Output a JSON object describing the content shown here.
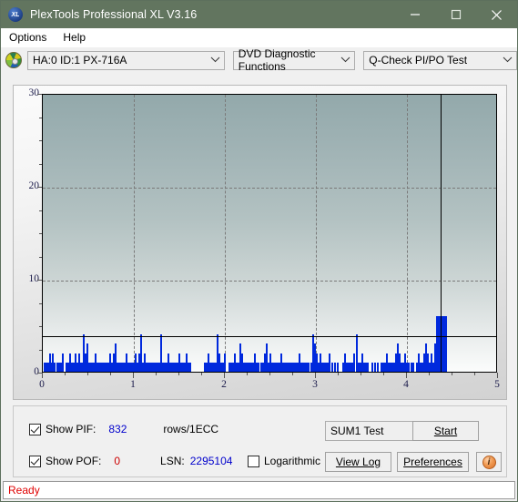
{
  "window": {
    "title": "PlexTools Professional XL V3.16",
    "app_icon": "XL",
    "minimize_icon": "minimize-icon",
    "maximize_icon": "maximize-icon",
    "close_icon": "close-icon"
  },
  "menubar": {
    "items": [
      {
        "label": "Options"
      },
      {
        "label": "Help"
      }
    ]
  },
  "toolbar": {
    "disc_icon": "disc-icon",
    "drive_select": {
      "value": "HA:0 ID:1  PX-716A",
      "caret": "⌄"
    },
    "function_select": {
      "value": "DVD Diagnostic Functions",
      "caret": "⌄"
    },
    "test_select": {
      "value": "Q-Check PI/PO Test",
      "caret": "⌄"
    }
  },
  "controls": {
    "show_pif": {
      "label": "Show PIF:",
      "checked": true,
      "value": "832",
      "unit": "rows/1ECC"
    },
    "show_pof": {
      "label": "Show POF:",
      "checked": true,
      "value": "0"
    },
    "lsn": {
      "label": "LSN:",
      "value": "2295104"
    },
    "logarithmic": {
      "label": "Logarithmic",
      "checked": false
    },
    "sum_select": {
      "value": "SUM1 Test",
      "caret": "⌄"
    },
    "start_button": "Start",
    "view_log_button": "View Log",
    "preferences_button": "Preferences",
    "info_button": "i"
  },
  "statusbar": {
    "text": "Ready"
  },
  "colors": {
    "titlebar": "#62755f",
    "bar_blue": "#0029dd",
    "baseline_teal": "#00c8c8",
    "value_blue": "#0000cc",
    "value_red": "#cc0000",
    "status_red": "#e00000"
  },
  "chart_data": {
    "type": "bar",
    "title": "",
    "xlabel": "",
    "ylabel": "",
    "xlim": [
      0,
      5
    ],
    "ylim": [
      0,
      30
    ],
    "xticks": [
      0,
      1,
      2,
      3,
      4,
      5
    ],
    "xtick_labels": [
      "0",
      "1",
      "2",
      "3",
      "4",
      "5"
    ],
    "yticks": [
      0,
      10,
      20,
      30
    ],
    "ytick_labels": [
      "0",
      "10",
      "20",
      "30"
    ],
    "y_minor_ticks": [
      2.5,
      5,
      7.5,
      12.5,
      15,
      17.5,
      22.5,
      25,
      27.5
    ],
    "x_minor_ticks": [
      0.25,
      0.5,
      0.75,
      1.25,
      1.5,
      1.75,
      2.25,
      2.5,
      2.75,
      3.25,
      3.5,
      3.75,
      4.25,
      4.5,
      4.75
    ],
    "grid": {
      "vertical_dashed_at": [
        1,
        2,
        3,
        4
      ],
      "horizontal_dashed_at": [
        10,
        20
      ]
    },
    "threshold_line": {
      "y": 4,
      "color": "#000000"
    },
    "data_end_line": {
      "x": 4.37,
      "color": "#000000"
    },
    "baseline": {
      "y": 0,
      "color": "#00c8c8",
      "x_end": 4.37
    },
    "series": [
      {
        "name": "PIF",
        "color": "#0029dd",
        "points": [
          [
            0.02,
            1
          ],
          [
            0.04,
            1
          ],
          [
            0.055,
            1
          ],
          [
            0.075,
            2
          ],
          [
            0.09,
            1
          ],
          [
            0.105,
            2
          ],
          [
            0.125,
            1
          ],
          [
            0.155,
            1
          ],
          [
            0.175,
            1
          ],
          [
            0.195,
            1
          ],
          [
            0.215,
            2
          ],
          [
            0.255,
            1
          ],
          [
            0.275,
            1
          ],
          [
            0.3,
            2
          ],
          [
            0.315,
            1
          ],
          [
            0.335,
            1
          ],
          [
            0.355,
            2
          ],
          [
            0.375,
            1
          ],
          [
            0.395,
            2
          ],
          [
            0.415,
            1
          ],
          [
            0.435,
            1
          ],
          [
            0.45,
            4
          ],
          [
            0.465,
            2
          ],
          [
            0.485,
            3
          ],
          [
            0.5,
            1
          ],
          [
            0.515,
            1
          ],
          [
            0.535,
            1
          ],
          [
            0.555,
            1
          ],
          [
            0.575,
            2
          ],
          [
            0.595,
            1
          ],
          [
            0.615,
            1
          ],
          [
            0.635,
            1
          ],
          [
            0.66,
            1
          ],
          [
            0.68,
            1
          ],
          [
            0.7,
            1
          ],
          [
            0.715,
            1
          ],
          [
            0.735,
            2
          ],
          [
            0.755,
            1
          ],
          [
            0.775,
            2
          ],
          [
            0.8,
            3
          ],
          [
            0.815,
            1
          ],
          [
            0.835,
            1
          ],
          [
            0.855,
            1
          ],
          [
            0.875,
            1
          ],
          [
            0.895,
            1
          ],
          [
            0.915,
            2
          ],
          [
            0.935,
            1
          ],
          [
            0.955,
            1
          ],
          [
            0.975,
            1
          ],
          [
            0.995,
            1
          ],
          [
            1.015,
            2
          ],
          [
            1.035,
            1
          ],
          [
            1.055,
            2
          ],
          [
            1.075,
            4
          ],
          [
            1.095,
            1
          ],
          [
            1.115,
            2
          ],
          [
            1.135,
            1
          ],
          [
            1.155,
            1
          ],
          [
            1.175,
            1
          ],
          [
            1.195,
            1
          ],
          [
            1.215,
            1
          ],
          [
            1.235,
            1
          ],
          [
            1.255,
            1
          ],
          [
            1.275,
            1
          ],
          [
            1.295,
            4
          ],
          [
            1.315,
            1
          ],
          [
            1.335,
            1
          ],
          [
            1.355,
            1
          ],
          [
            1.375,
            2
          ],
          [
            1.395,
            1
          ],
          [
            1.415,
            1
          ],
          [
            1.435,
            1
          ],
          [
            1.455,
            1
          ],
          [
            1.475,
            1
          ],
          [
            1.495,
            2
          ],
          [
            1.515,
            1
          ],
          [
            1.535,
            1
          ],
          [
            1.555,
            1
          ],
          [
            1.575,
            2
          ],
          [
            1.595,
            1
          ],
          [
            1.615,
            1
          ],
          [
            1.78,
            1
          ],
          [
            1.8,
            1
          ],
          [
            1.82,
            2
          ],
          [
            1.84,
            1
          ],
          [
            1.86,
            1
          ],
          [
            1.88,
            1
          ],
          [
            1.9,
            1
          ],
          [
            1.92,
            4
          ],
          [
            1.94,
            2
          ],
          [
            1.96,
            1
          ],
          [
            1.98,
            1
          ],
          [
            2.0,
            2
          ],
          [
            2.05,
            1
          ],
          [
            2.07,
            1
          ],
          [
            2.09,
            1
          ],
          [
            2.11,
            2
          ],
          [
            2.13,
            1
          ],
          [
            2.15,
            1
          ],
          [
            2.17,
            3
          ],
          [
            2.19,
            2
          ],
          [
            2.21,
            1
          ],
          [
            2.23,
            1
          ],
          [
            2.25,
            1
          ],
          [
            2.27,
            1
          ],
          [
            2.29,
            1
          ],
          [
            2.31,
            1
          ],
          [
            2.33,
            2
          ],
          [
            2.35,
            1
          ],
          [
            2.37,
            1
          ],
          [
            2.4,
            1
          ],
          [
            2.42,
            1
          ],
          [
            2.44,
            2
          ],
          [
            2.46,
            3
          ],
          [
            2.48,
            1
          ],
          [
            2.5,
            2
          ],
          [
            2.52,
            1
          ],
          [
            2.54,
            1
          ],
          [
            2.56,
            1
          ],
          [
            2.58,
            1
          ],
          [
            2.6,
            1
          ],
          [
            2.62,
            2
          ],
          [
            2.64,
            1
          ],
          [
            2.66,
            1
          ],
          [
            2.68,
            1
          ],
          [
            2.7,
            1
          ],
          [
            2.72,
            1
          ],
          [
            2.74,
            1
          ],
          [
            2.76,
            1
          ],
          [
            2.78,
            1
          ],
          [
            2.8,
            1
          ],
          [
            2.82,
            2
          ],
          [
            2.84,
            1
          ],
          [
            2.86,
            1
          ],
          [
            2.88,
            1
          ],
          [
            2.9,
            1
          ],
          [
            2.92,
            1
          ],
          [
            2.95,
            1
          ],
          [
            2.97,
            4
          ],
          [
            2.99,
            3
          ],
          [
            3.01,
            2
          ],
          [
            3.03,
            1
          ],
          [
            3.05,
            2
          ],
          [
            3.07,
            1
          ],
          [
            3.09,
            1
          ],
          [
            3.11,
            1
          ],
          [
            3.13,
            1
          ],
          [
            3.15,
            2
          ],
          [
            3.18,
            1
          ],
          [
            3.21,
            1
          ],
          [
            3.24,
            1
          ],
          [
            3.3,
            1
          ],
          [
            3.32,
            2
          ],
          [
            3.34,
            1
          ],
          [
            3.36,
            1
          ],
          [
            3.38,
            1
          ],
          [
            3.4,
            1
          ],
          [
            3.42,
            2
          ],
          [
            3.45,
            4
          ],
          [
            3.47,
            1
          ],
          [
            3.49,
            1
          ],
          [
            3.51,
            2
          ],
          [
            3.53,
            1
          ],
          [
            3.55,
            1
          ],
          [
            3.57,
            1
          ],
          [
            3.62,
            1
          ],
          [
            3.65,
            1
          ],
          [
            3.68,
            1
          ],
          [
            3.72,
            1
          ],
          [
            3.74,
            1
          ],
          [
            3.76,
            1
          ],
          [
            3.78,
            2
          ],
          [
            3.8,
            1
          ],
          [
            3.82,
            1
          ],
          [
            3.84,
            1
          ],
          [
            3.86,
            1
          ],
          [
            3.88,
            2
          ],
          [
            3.9,
            3
          ],
          [
            3.92,
            2
          ],
          [
            3.94,
            1
          ],
          [
            3.96,
            1
          ],
          [
            3.98,
            2
          ],
          [
            4.0,
            1
          ],
          [
            4.02,
            1
          ],
          [
            4.05,
            1
          ],
          [
            4.07,
            1
          ],
          [
            4.11,
            1
          ],
          [
            4.13,
            2
          ],
          [
            4.15,
            1
          ],
          [
            4.17,
            1
          ],
          [
            4.19,
            2
          ],
          [
            4.21,
            3
          ],
          [
            4.23,
            2
          ],
          [
            4.25,
            1
          ],
          [
            4.27,
            2
          ],
          [
            4.29,
            1
          ],
          [
            4.31,
            3
          ],
          [
            4.33,
            6
          ],
          [
            4.345,
            6
          ],
          [
            4.36,
            6
          ]
        ]
      }
    ]
  }
}
